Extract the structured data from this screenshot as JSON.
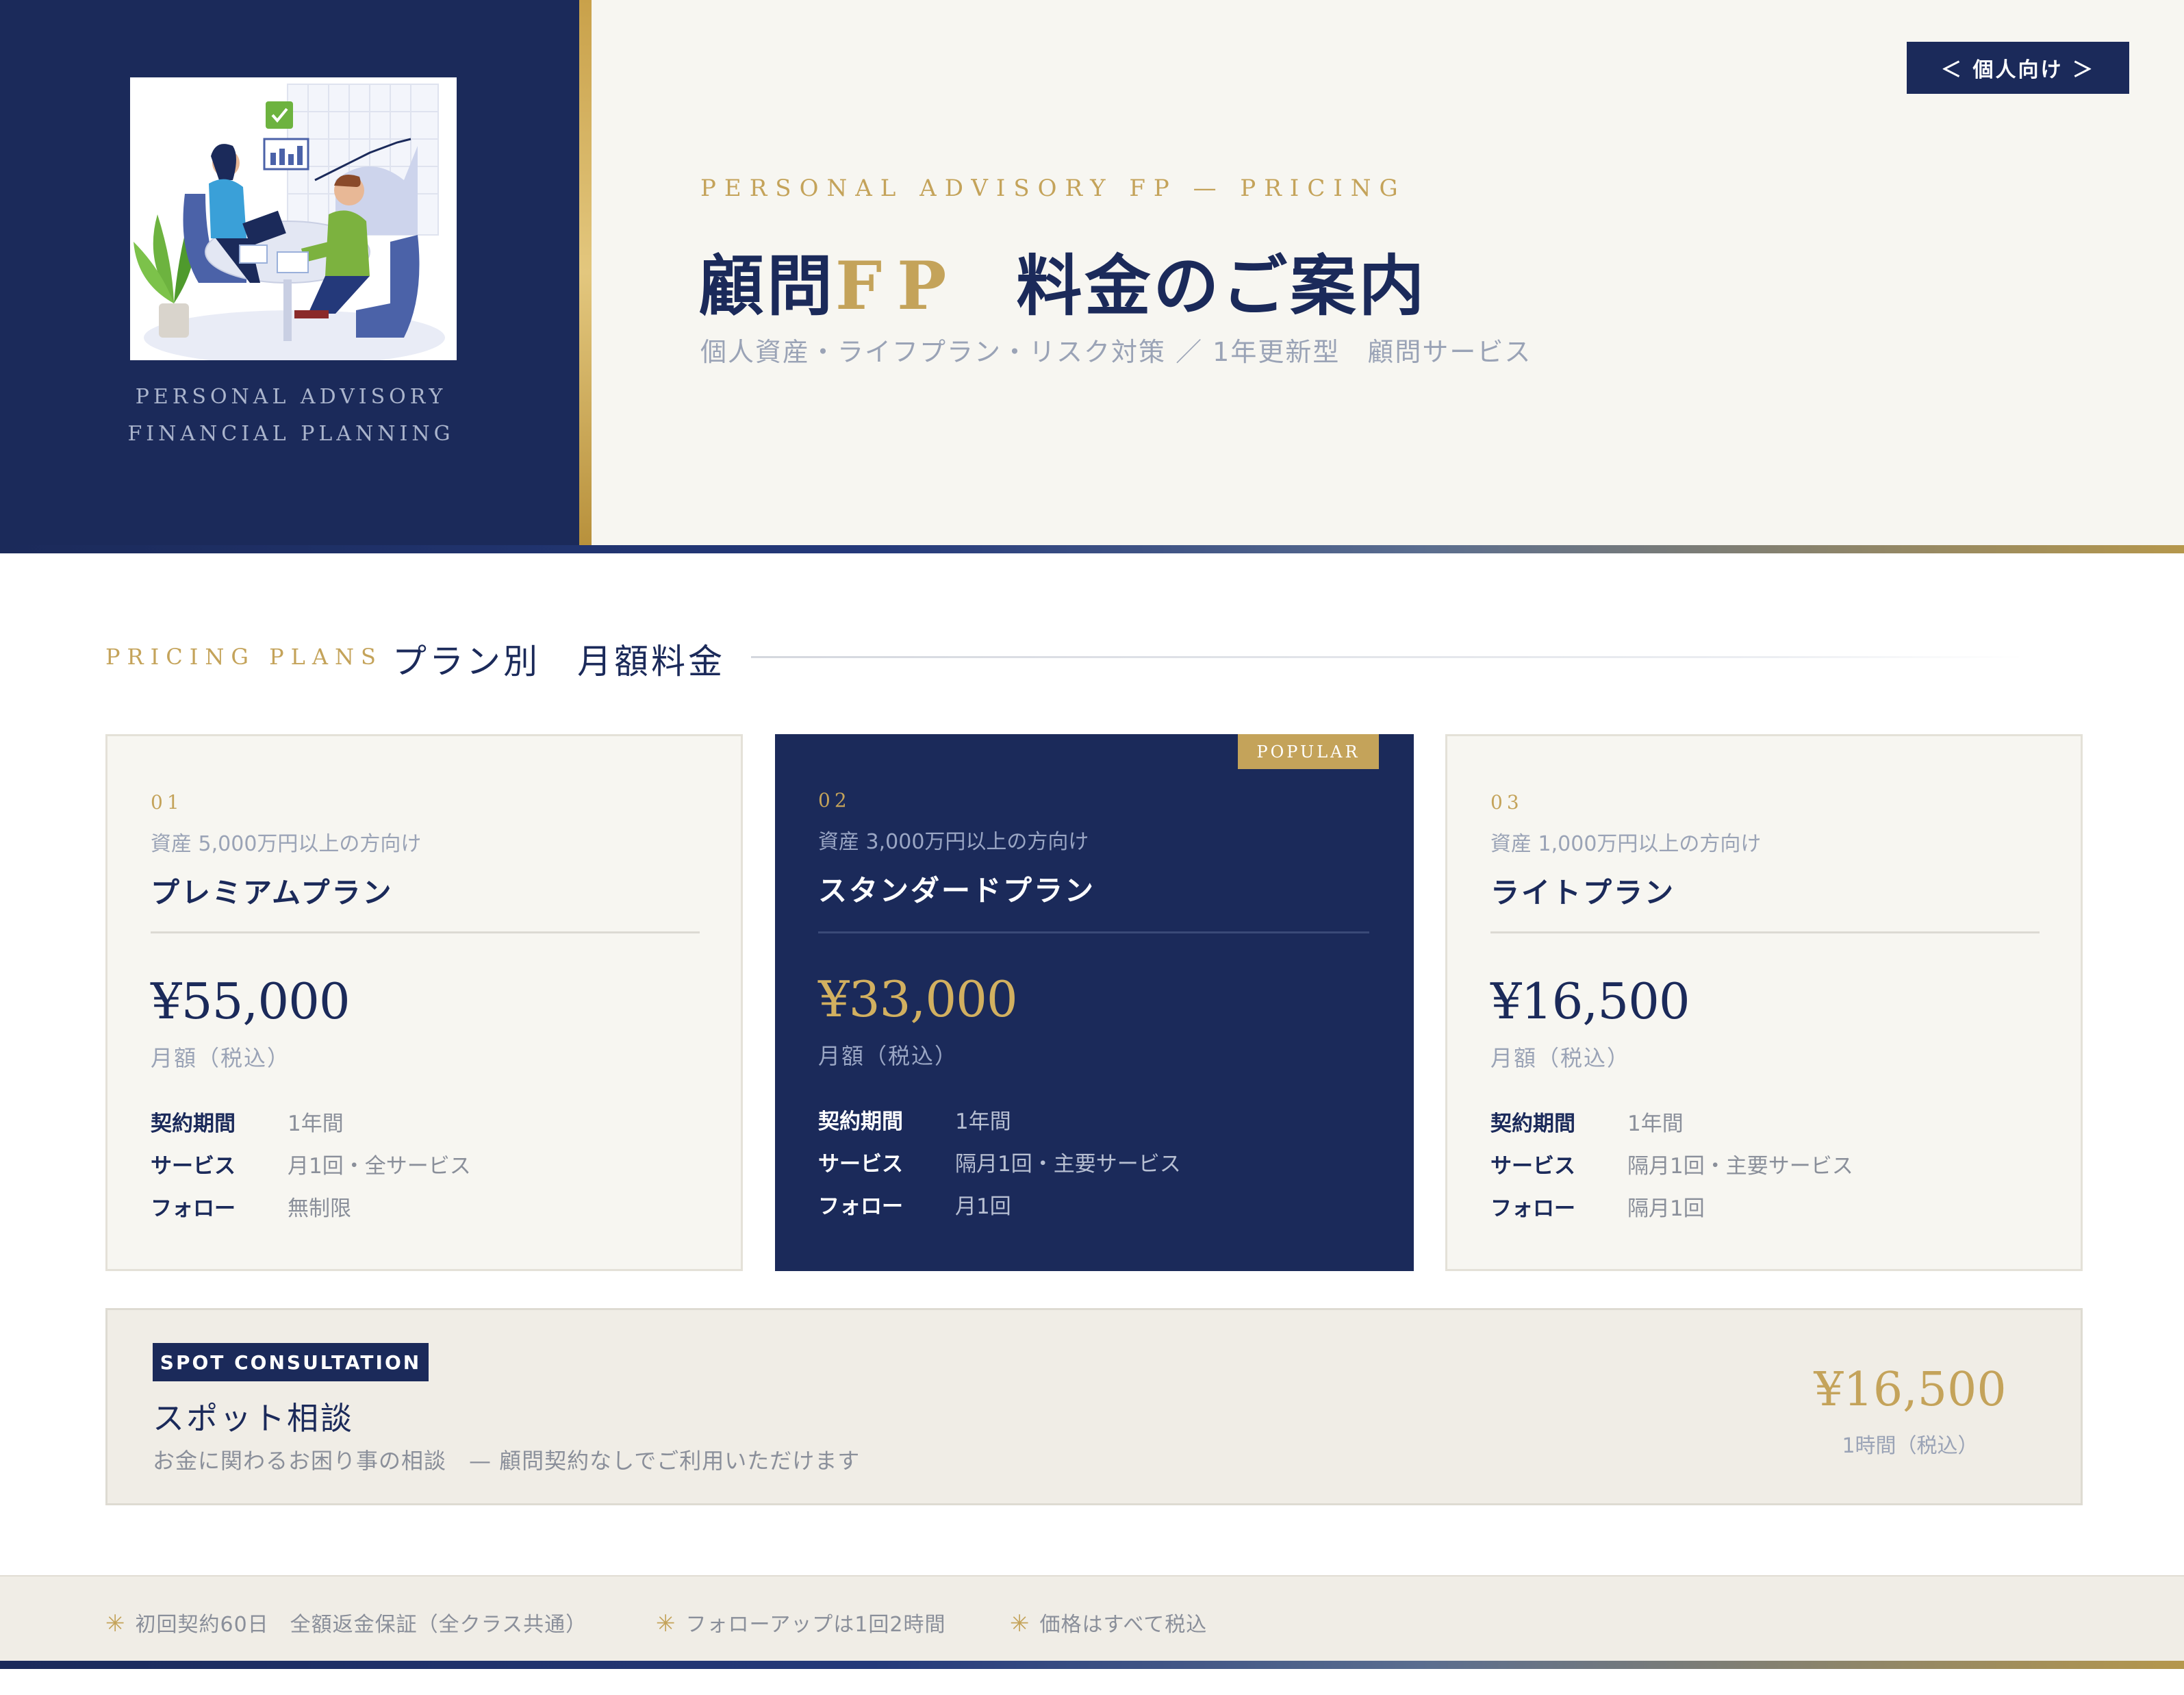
{
  "hero": {
    "brand": [
      "PERSONAL ADVISORY",
      "FINANCIAL PLANNING"
    ],
    "tag_button": "＜ 個人向け ＞",
    "eyebrow": "PERSONAL ADVISORY FP — PRICING",
    "title_a": "顧問",
    "title_gold": "FP",
    "title_b": "料金のご案内",
    "subtitle": "個人資産・ライフプラン・リスク対策 ／ 1年更新型　顧問サービス"
  },
  "section": {
    "eyebrow": "PRICING PLANS",
    "title": "プラン別　月額料金"
  },
  "plans": [
    {
      "num": "01",
      "target": "資産 5,000万円以上の方向け",
      "name": "プレミアムプラン",
      "price": "¥55,000",
      "unit": "月額（税込）",
      "rows": [
        {
          "k": "契約期間",
          "v": "1年間"
        },
        {
          "k": "サービス",
          "v": "月1回・全サービス"
        },
        {
          "k": "フォロー",
          "v": "無制限"
        }
      ]
    },
    {
      "num": "02",
      "target": "資産 3,000万円以上の方向け",
      "name": "スタンダードプラン",
      "price": "¥33,000",
      "unit": "月額（税込）",
      "badge": "POPULAR",
      "rows": [
        {
          "k": "契約期間",
          "v": "1年間"
        },
        {
          "k": "サービス",
          "v": "隔月1回・主要サービス"
        },
        {
          "k": "フォロー",
          "v": "月1回"
        }
      ]
    },
    {
      "num": "03",
      "target": "資産 1,000万円以上の方向け",
      "name": "ライトプラン",
      "price": "¥16,500",
      "unit": "月額（税込）",
      "rows": [
        {
          "k": "契約期間",
          "v": "1年間"
        },
        {
          "k": "サービス",
          "v": "隔月1回・主要サービス"
        },
        {
          "k": "フォロー",
          "v": "隔月1回"
        }
      ]
    }
  ],
  "spot": {
    "tag": "SPOT CONSULTATION",
    "name": "スポット相談",
    "desc": "お金に関わるお困り事の相談　— 顧問契約なしでご利用いただけます",
    "price": "¥16,500",
    "unit": "1時間（税込）"
  },
  "notes": [
    "初回契約60日　全額返金保証（全クラス共通）",
    "フォローアップは1回2時間",
    "価格はすべて税込"
  ],
  "colors": {
    "navy": "#1b2a5a",
    "gold": "#c4a35a",
    "cream": "#f7f6f1"
  }
}
